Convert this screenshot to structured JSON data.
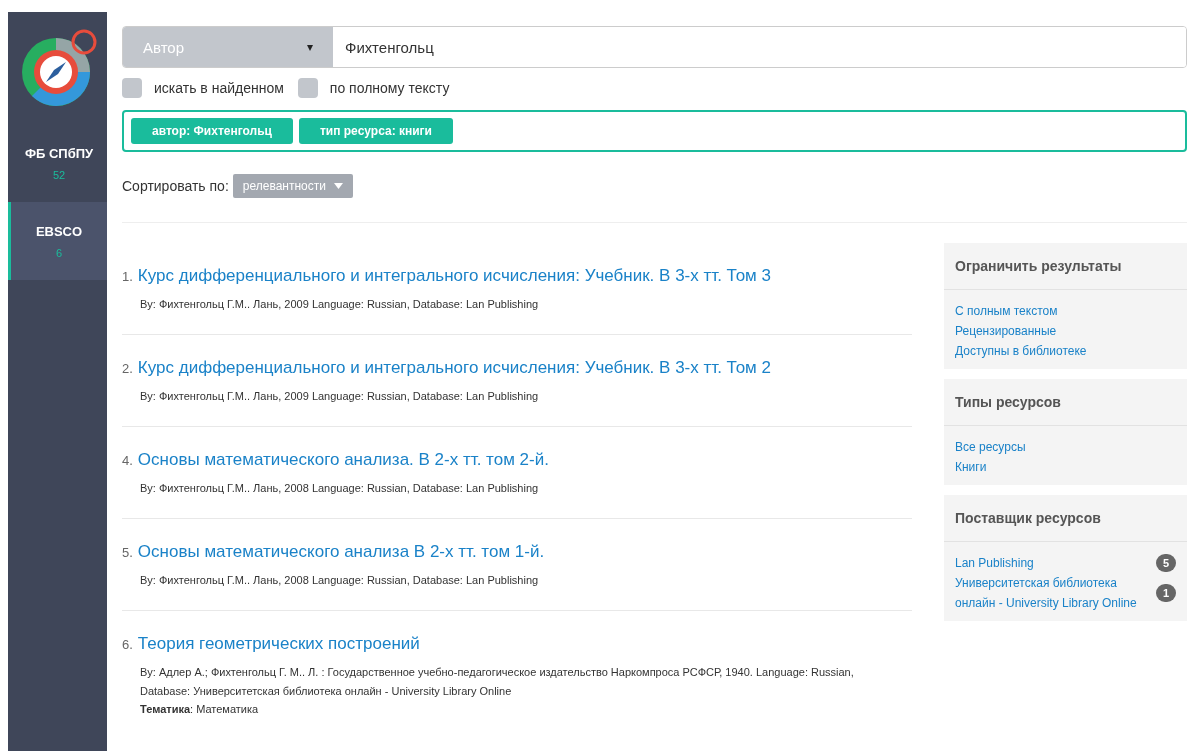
{
  "sidebar": {
    "items": [
      {
        "label": "ФБ СПбПУ",
        "count": "52",
        "selected": false
      },
      {
        "label": "EBSCO",
        "count": "6",
        "selected": true
      }
    ]
  },
  "search": {
    "field": "Автор",
    "caret": "▾",
    "value": "Фихтенгольц"
  },
  "options": [
    {
      "label": "искать в найденном",
      "checked": false
    },
    {
      "label": "по полному тексту",
      "checked": false
    }
  ],
  "filters": [
    "автор: Фихтенгольц",
    "тип ресурса: книги"
  ],
  "sort": {
    "label": "Сортировать по:",
    "value": "релевантности"
  },
  "results": [
    {
      "number": "1.",
      "title": "Курс дифференциального и интегрального исчисления: Учебник. В 3-х тт. Том 3",
      "meta": "By: Фихтенгольц Г.М.. Лань, 2009 Language: Russian, Database: Lan Publishing"
    },
    {
      "number": "2.",
      "title": "Курс дифференциального и интегрального исчисления: Учебник. В 3-х тт. Том 2",
      "meta": "By: Фихтенгольц Г.М.. Лань, 2009 Language: Russian, Database: Lan Publishing"
    },
    {
      "number": "4.",
      "title": "Основы математического анализа. В 2-х тт. том 2-й.",
      "meta": "By: Фихтенгольц Г.М.. Лань, 2008 Language: Russian, Database: Lan Publishing"
    },
    {
      "number": "5.",
      "title": "Основы математического анализа В 2-х тт. том 1-й.",
      "meta": "By: Фихтенгольц Г.М.. Лань, 2008 Language: Russian, Database: Lan Publishing"
    },
    {
      "number": "6.",
      "title": "Теория геометрических построений",
      "meta": "By: Адлер А.; Фихтенгольц Г. М.. Л. : Государственное учебно-педагогическое издательство Наркомпроса РСФСР, 1940. Language: Russian, Database: Университетская библиотека онлайн - University Library Online",
      "topic": "**Тематика**: Математика"
    }
  ],
  "panels": [
    {
      "title": "Ограничить результаты",
      "links": [
        {
          "label": "С полным текстом"
        },
        {
          "label": "Рецензированные"
        },
        {
          "label": "Доступны в библиотеке"
        }
      ]
    },
    {
      "title": "Типы ресурсов",
      "links": [
        {
          "label": "Все ресурсы"
        },
        {
          "label": "Книги"
        }
      ]
    },
    {
      "title": "Поставщик ресурсов",
      "links": [
        {
          "label": "Lan Publishing",
          "count": "5"
        },
        {
          "label": "Университетская библиотека онлайн - University Library Online",
          "count": "1"
        }
      ]
    }
  ]
}
